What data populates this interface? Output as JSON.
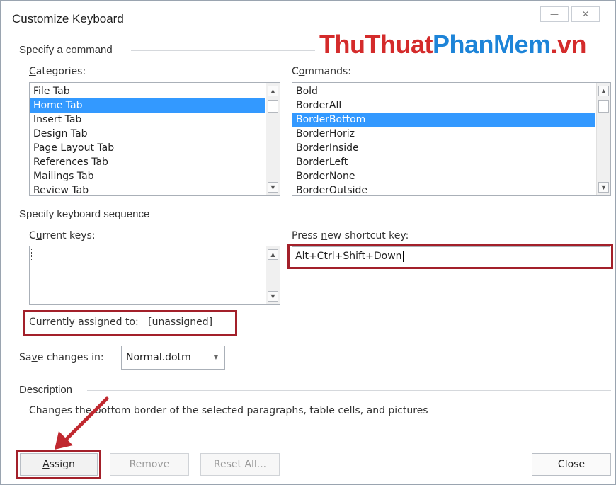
{
  "window": {
    "title": "Customize Keyboard",
    "minimize_glyph": "—",
    "close_glyph": "✕"
  },
  "watermark": {
    "part1": "ThuThuat",
    "part2": "PhanMem",
    "part3": ".vn"
  },
  "specify_command": {
    "group_label": "Specify a command",
    "categories": {
      "label_key": "C",
      "label_rest": "ategories:",
      "items": [
        "File Tab",
        "Home Tab",
        "Insert Tab",
        "Design Tab",
        "Page Layout Tab",
        "References Tab",
        "Mailings Tab",
        "Review Tab"
      ],
      "selected_index": 1
    },
    "commands": {
      "label_key": "o",
      "label_pre": "C",
      "label_rest": "mmands:",
      "items": [
        "Bold",
        "BorderAll",
        "BorderBottom",
        "BorderHoriz",
        "BorderInside",
        "BorderLeft",
        "BorderNone",
        "BorderOutside"
      ],
      "selected_index": 2
    }
  },
  "keyboard_sequence": {
    "group_label": "Specify keyboard sequence",
    "current_keys_pre": "C",
    "current_keys_key": "u",
    "current_keys_rest": "rrent keys:",
    "press_new_pre": "Press ",
    "press_new_key": "n",
    "press_new_rest": "ew shortcut key:",
    "shortcut_value": "Alt+Ctrl+Shift+Down",
    "assigned_label": "Currently assigned to:",
    "assigned_value": "[unassigned]"
  },
  "save_changes": {
    "label_pre": "Sa",
    "label_key": "v",
    "label_rest": "e changes in:",
    "value": "Normal.dotm"
  },
  "description": {
    "group_label": "Description",
    "text": "Changes the bottom border of the selected paragraphs, table cells, and pictures"
  },
  "buttons": {
    "assign_key": "A",
    "assign_rest": "ssign",
    "remove": "Remove",
    "reset_all": "Reset All...",
    "close": "Close"
  },
  "colors": {
    "selection": "#3399ff",
    "highlight_box": "#a3202a",
    "arrow": "#c0282f",
    "watermark_red": "#d42b2b",
    "watermark_blue": "#1d84d8"
  },
  "icons": {
    "minimize": "minimize-icon",
    "close": "close-icon",
    "scroll_up": "scroll-up-arrow-icon",
    "scroll_down": "scroll-down-arrow-icon",
    "dropdown": "chevron-down-icon",
    "annotation_arrow": "annotation-arrow-icon"
  }
}
